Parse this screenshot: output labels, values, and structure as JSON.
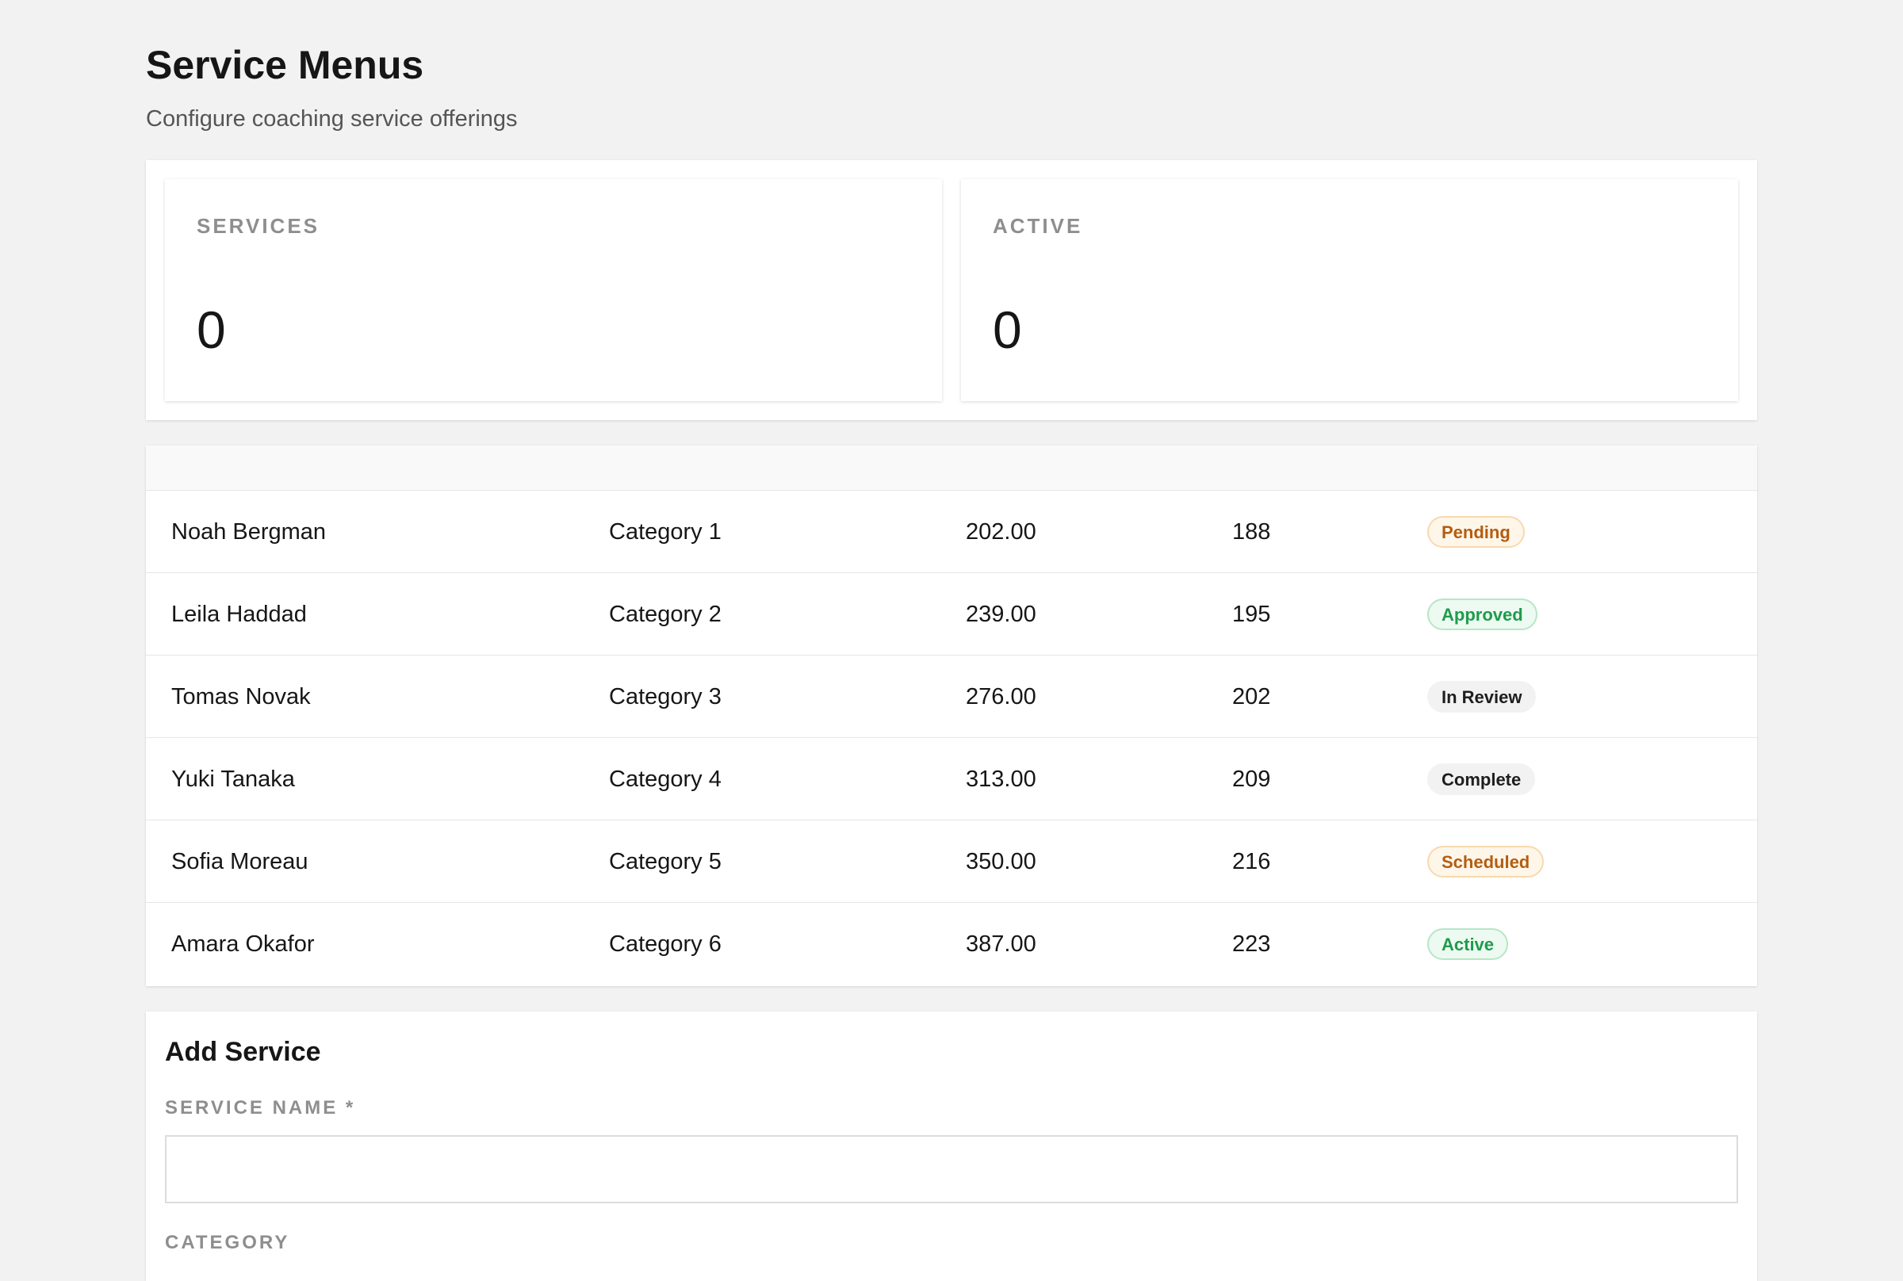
{
  "header": {
    "title": "Service Menus",
    "subtitle": "Configure coaching service offerings"
  },
  "stats": [
    {
      "label": "SERVICES",
      "value": "0"
    },
    {
      "label": "ACTIVE",
      "value": "0"
    }
  ],
  "table": {
    "rows": [
      {
        "name": "Noah Bergman",
        "category": "Category 1",
        "price": "202.00",
        "count": "188",
        "status": "Pending",
        "status_color": "#b45d10"
      },
      {
        "name": "Leila Haddad",
        "category": "Category 2",
        "price": "239.00",
        "count": "195",
        "status": "Approved",
        "status_color": "#1f9b4c"
      },
      {
        "name": "Tomas Novak",
        "category": "Category 3",
        "price": "276.00",
        "count": "202",
        "status": "In Review",
        "status_color": "#1e1e1e"
      },
      {
        "name": "Yuki Tanaka",
        "category": "Category 4",
        "price": "313.00",
        "count": "209",
        "status": "Complete",
        "status_color": "#1e1e1e"
      },
      {
        "name": "Sofia Moreau",
        "category": "Category 5",
        "price": "350.00",
        "count": "216",
        "status": "Scheduled",
        "status_color": "#b45d10"
      },
      {
        "name": "Amara Okafor",
        "category": "Category 6",
        "price": "387.00",
        "count": "223",
        "status": "Active",
        "status_color": "#1f9b4c"
      }
    ]
  },
  "form": {
    "title": "Add Service",
    "service_name_label": "SERVICE NAME *",
    "service_name_value": "",
    "category_label": "CATEGORY"
  }
}
